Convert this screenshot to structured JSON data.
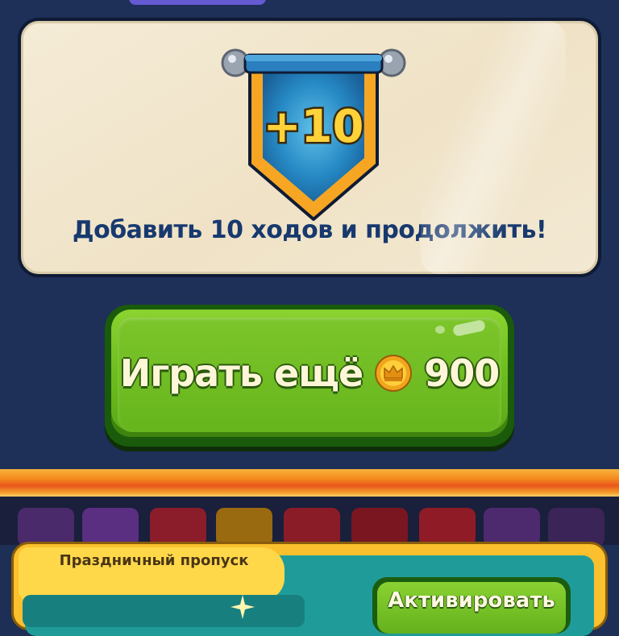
{
  "offer": {
    "badge_text": "+10",
    "message": "Добавить 10 ходов и продолжить!"
  },
  "play_button": {
    "label": "Играть ещё",
    "currency_icon": "crown-coin-icon",
    "cost": "900"
  },
  "festive_pass": {
    "label": "Праздничный пропуск",
    "activate_label": "Активировать"
  },
  "colors": {
    "frame": "#1e2f58",
    "card": "#f3e9d3",
    "text_dark_blue": "#17396e",
    "button_green": "#6fbf1f",
    "banner_blue": "#1f7fb6",
    "banner_gold": "#f6a623",
    "stripe_orange": "#f48a1e",
    "pass_yellow": "#fbc02d",
    "pass_teal": "#1f9c9a"
  }
}
